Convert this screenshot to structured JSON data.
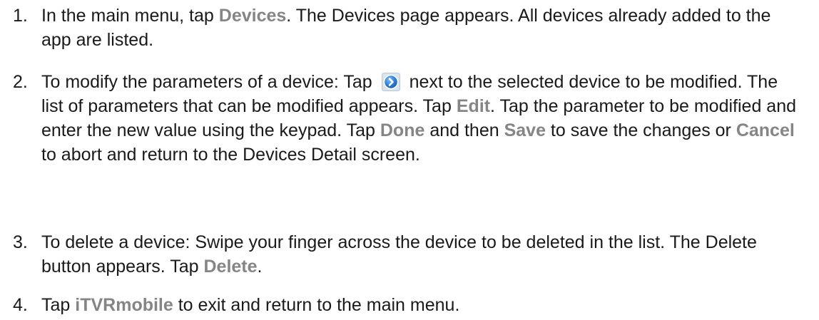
{
  "steps": [
    {
      "number": "1.",
      "pre": "In the main menu, tap ",
      "kw1": "Devices",
      "post": ". The Devices page appears. All devices already added to the app are listed."
    },
    {
      "number": "2.",
      "a": "To modify the parameters of a device: Tap ",
      "icon": "forward-arrow-icon",
      "b": " next to the selected device to be modified. The list of parameters that can be modified appears. Tap ",
      "kw_edit": "Edit",
      "c": ". Tap the parameter to be modified and enter the new value using the keypad. Tap ",
      "kw_done": "Done",
      "d": " and then ",
      "kw_save": "Save",
      "e": " to save the changes or ",
      "kw_cancel": "Cancel",
      "f": " to abort and return to the Devices Detail screen."
    },
    {
      "number": "3.",
      "pre": "To delete a device: Swipe your finger across the device to be deleted in the list. The Delete button appears. Tap ",
      "kw1": "Delete",
      "post": "."
    },
    {
      "number": "4.",
      "pre": "Tap ",
      "kw1": "iTVRmobile",
      "post": " to exit and return to the main menu."
    }
  ],
  "colors": {
    "keyword": "#858585",
    "text": "#1a1a1a",
    "icon_blue": "#2f7fd6"
  }
}
